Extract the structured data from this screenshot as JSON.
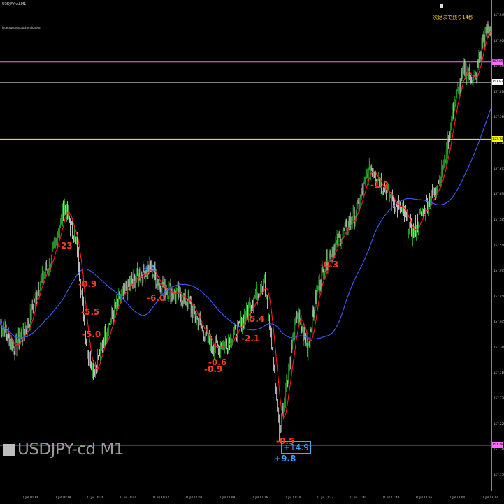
{
  "window": {
    "symbol_tag": "USDJPY-cd,M1",
    "auth_message": "true,success authentication",
    "countdown": "次足まで残り14秒",
    "watermark": "USDJPY-cd M1"
  },
  "colors": {
    "background": "#000000",
    "candle_up": "#2fbf2f",
    "ma_fast": "#ff1a1a",
    "ma_slow": "#3b5bff",
    "level_magenta": "#ff6bff",
    "level_yellow": "#ffff00",
    "level_white": "#cccccc",
    "signal_red": "#ff3b1f",
    "signal_blue": "#4aa3ff"
  },
  "price_axis": {
    "ticks": [
      "157.945",
      "157.900",
      "157.855",
      "157.810",
      "157.765",
      "157.720",
      "157.675",
      "157.630",
      "157.585",
      "157.540",
      "157.495",
      "157.450",
      "157.405",
      "157.360",
      "157.315",
      "157.270",
      "157.225",
      "157.180",
      "157.135"
    ]
  },
  "price_badges": [
    {
      "label": "157.863",
      "color": "#ff6bff",
      "text_color": "#000000",
      "level": 157.863
    },
    {
      "label": "157.827",
      "color": "#ffffff",
      "text_color": "#000000",
      "level": 157.827
    },
    {
      "label": "157.727",
      "color": "#ffff00",
      "text_color": "#000000",
      "level": 157.727
    },
    {
      "label": "157.188",
      "color": "#ff6bff",
      "text_color": "#000000",
      "level": 157.188
    }
  ],
  "time_axis": {
    "ticks": [
      "11 Jul 10:20",
      "11 Jul 10:28",
      "11 Jul 10:36",
      "11 Jul 10:44",
      "11 Jul 10:52",
      "11 Jul 11:00",
      "11 Jul 11:08",
      "11 Jul 11:16",
      "11 Jul 11:24",
      "11 Jul 11:32",
      "11 Jul 11:40",
      "11 Jul 11:48",
      "11 Jul 11:56",
      "11 Jul 12:04",
      "11 Jul 12:12"
    ]
  },
  "signals": [
    {
      "text": "-23",
      "class": "sig-red",
      "name": "signal-label"
    },
    {
      "text": "-0.9",
      "class": "sig-red",
      "name": "signal-label"
    },
    {
      "text": "-5.5",
      "class": "sig-red",
      "name": "signal-label"
    },
    {
      "text": "-5.0",
      "class": "sig-red",
      "name": "signal-label"
    },
    {
      "text": "+4",
      "class": "sig-blue",
      "name": "signal-label"
    },
    {
      "text": "-6.0",
      "class": "sig-red",
      "name": "signal-label"
    },
    {
      "text": "-0.9",
      "class": "sig-red",
      "name": "signal-label"
    },
    {
      "text": "-0.6",
      "class": "sig-red",
      "name": "signal-label"
    },
    {
      "text": "-5.4",
      "class": "sig-red",
      "name": "signal-label"
    },
    {
      "text": "-2.1",
      "class": "sig-red",
      "name": "signal-label"
    },
    {
      "text": "-0.3",
      "class": "sig-red",
      "name": "signal-label"
    },
    {
      "text": "+9.8",
      "class": "sig-blue",
      "name": "signal-label"
    },
    {
      "text": "-0.5",
      "class": "sig-red",
      "name": "signal-label"
    },
    {
      "text": "-1.2",
      "class": "sig-red",
      "name": "signal-label"
    }
  ],
  "profit_box": "+14.9"
}
